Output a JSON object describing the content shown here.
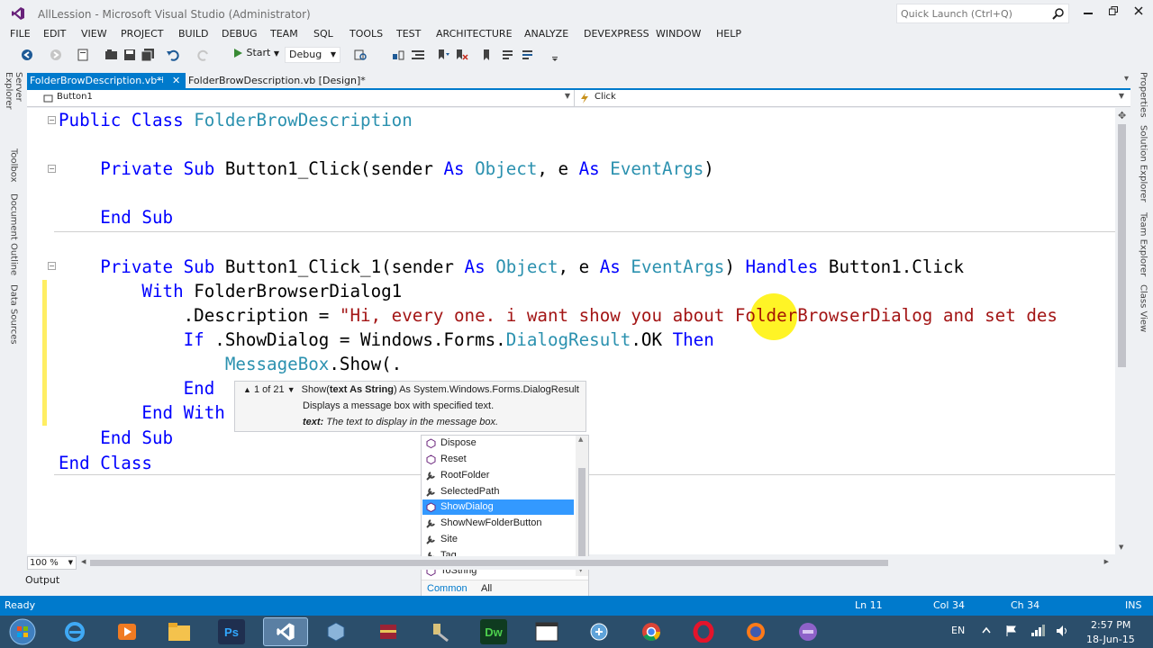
{
  "window": {
    "title": "AllLession - Microsoft Visual Studio (Administrator)",
    "quick_launch_placeholder": "Quick Launch (Ctrl+Q)",
    "accent": "#007acc"
  },
  "menu": [
    "FILE",
    "EDIT",
    "VIEW",
    "PROJECT",
    "BUILD",
    "DEBUG",
    "TEAM",
    "SQL",
    "TOOLS",
    "TEST",
    "ARCHITECTURE",
    "ANALYZE",
    "DEVEXPRESS",
    "WINDOW",
    "HELP"
  ],
  "toolbar": {
    "start_label": "Start",
    "config_value": "Debug"
  },
  "left_tabs": [
    "Server Explorer",
    "Toolbox",
    "Document Outline",
    "Data Sources"
  ],
  "right_tabs": [
    "Properties",
    "Solution Explorer",
    "Team Explorer",
    "Class View"
  ],
  "doc_tabs": {
    "active": "FolderBrowDescription.vb*",
    "inactive": "FolderBrowDescription.vb [Design]*"
  },
  "navbar": {
    "left": "Button1",
    "right": "Click"
  },
  "code": {
    "l1_kw": "Public Class ",
    "l1_ty": "FolderBrowDescription",
    "l2_a": "    Private Sub ",
    "l2_b": "Button1_Click(sender ",
    "l2_c": "As ",
    "l2_d": "Object",
    "l2_e": ", e ",
    "l2_f": "As ",
    "l2_g": "EventArgs",
    "l2_h": ")",
    "l3": "    End Sub",
    "l4_a": "    Private Sub ",
    "l4_b": "Button1_Click_1(sender ",
    "l4_c": "As ",
    "l4_d": "Object",
    "l4_e": ", e ",
    "l4_f": "As ",
    "l4_g": "EventArgs",
    "l4_h": ") ",
    "l4_i": "Handles ",
    "l4_j": "Button1.Click",
    "l5_a": "        With ",
    "l5_b": "FolderBrowserDialog1",
    "l6_a": "            .Description = ",
    "l6_b": "\"Hi, every one. i want show you about FolderBrowserDialog and set des",
    "l7_a": "            If ",
    "l7_b": ".ShowDialog = Windows.Forms.",
    "l7_c": "DialogResult",
    "l7_d": ".OK ",
    "l7_e": "Then",
    "l8_a": "                ",
    "l8_b": "MessageBox",
    "l8_c": ".Show(.",
    "l9": "            End",
    "l10": "        End With",
    "l11": "    End Sub",
    "l12": "End Class"
  },
  "signature": {
    "counter": "1 of 21",
    "sig_a": "Show(",
    "sig_b": "text As String",
    "sig_c": ") As System.Windows.Forms.DialogResult",
    "description": "Displays a message box with specified text.",
    "param_name": "text:",
    "param_desc": "The text to display in the message box."
  },
  "completion": {
    "items": [
      {
        "label": "Dispose",
        "icon": "method-icon"
      },
      {
        "label": "Reset",
        "icon": "method-icon"
      },
      {
        "label": "RootFolder",
        "icon": "property-icon"
      },
      {
        "label": "SelectedPath",
        "icon": "property-icon"
      },
      {
        "label": "ShowDialog",
        "icon": "method-icon"
      },
      {
        "label": "ShowNewFolderButton",
        "icon": "property-icon"
      },
      {
        "label": "Site",
        "icon": "property-icon"
      },
      {
        "label": "Tag",
        "icon": "property-icon"
      },
      {
        "label": "ToString",
        "icon": "method-icon"
      }
    ],
    "selected": "ShowDialog",
    "tab_common": "Common",
    "tab_all": "All"
  },
  "editor": {
    "zoom": "100 %",
    "output_tab": "Output"
  },
  "status": {
    "ready": "Ready",
    "line": "Ln 11",
    "col": "Col 34",
    "ch": "Ch 34",
    "mode": "INS"
  },
  "taskbar": {
    "lang": "EN",
    "time": "2:57 PM",
    "date": "18-Jun-15",
    "apps": [
      "start-orb-icon",
      "ie-icon",
      "media-player-icon",
      "file-explorer-icon",
      "photoshop-icon",
      "visual-studio-icon",
      "virtualbox-icon",
      "winrar-icon",
      "tools-icon",
      "dreamweaver-icon",
      "window-icon",
      "network-icon",
      "chrome-icon",
      "opera-icon",
      "firefox-icon",
      "vs-purple-icon"
    ]
  }
}
